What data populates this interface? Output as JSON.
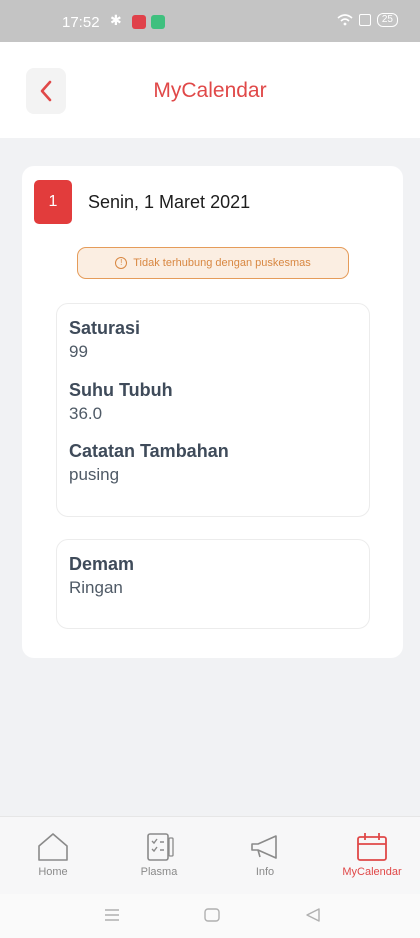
{
  "status_bar": {
    "time": "17:52",
    "battery": "25"
  },
  "header": {
    "title": "MyCalendar"
  },
  "entry": {
    "day_number": "1",
    "date": "Senin, 1 Maret 2021",
    "warning": "Tidak terhubung dengan puskesmas",
    "fields": [
      {
        "label": "Saturasi",
        "value": "99"
      },
      {
        "label": "Suhu Tubuh",
        "value": "36.0"
      },
      {
        "label": "Catatan Tambahan",
        "value": "pusing"
      }
    ],
    "symptom": {
      "label": "Demam",
      "value": "Ringan"
    }
  },
  "nav": {
    "items": [
      {
        "label": "Home",
        "icon": "home-icon"
      },
      {
        "label": "Plasma",
        "icon": "clipboard-icon"
      },
      {
        "label": "Info",
        "icon": "megaphone-icon"
      },
      {
        "label": "MyCalendar",
        "icon": "calendar-icon"
      }
    ],
    "active": "MyCalendar",
    "active_color": "#e04848"
  },
  "colors": {
    "accent": "#e04848",
    "warning": "#e59c5a"
  }
}
